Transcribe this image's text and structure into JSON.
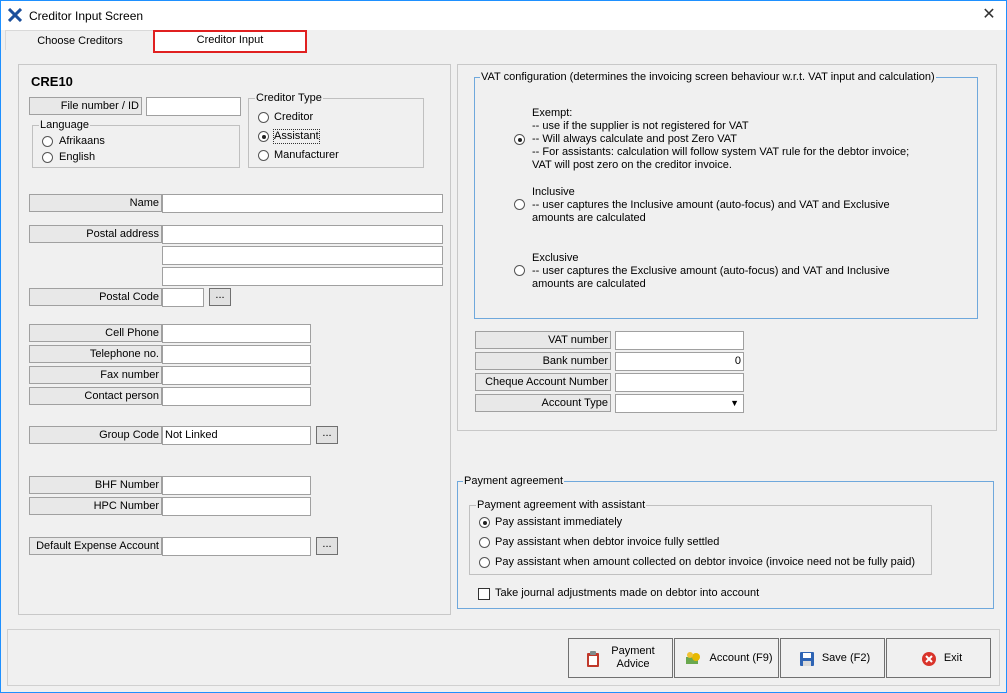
{
  "window": {
    "title": "Creditor Input Screen",
    "close_glyph": "✕"
  },
  "tabs": [
    {
      "label": "Choose Creditors"
    },
    {
      "label": "Creditor Input"
    }
  ],
  "left": {
    "code": "CRE10",
    "file_number": {
      "label": "File number / ID",
      "value": ""
    },
    "language": {
      "title": "Language",
      "options": [
        "Afrikaans",
        "English"
      ],
      "selected": ""
    },
    "creditor_type": {
      "title": "Creditor Type",
      "options": [
        "Creditor",
        "Assistant",
        "Manufacturer"
      ],
      "selected": "Assistant"
    },
    "name": {
      "label": "Name",
      "value": ""
    },
    "postal_address": {
      "label": "Postal address",
      "lines": [
        "",
        "",
        ""
      ]
    },
    "postal_code": {
      "label": "Postal Code",
      "value": "",
      "lookup": "..."
    },
    "cell_phone": {
      "label": "Cell Phone",
      "value": ""
    },
    "telephone": {
      "label": "Telephone no.",
      "value": ""
    },
    "fax": {
      "label": "Fax number",
      "value": ""
    },
    "contact": {
      "label": "Contact person",
      "value": ""
    },
    "group_code": {
      "label": "Group Code",
      "value": "Not Linked",
      "lookup": "..."
    },
    "bhf": {
      "label": "BHF Number",
      "value": ""
    },
    "hpc": {
      "label": "HPC Number",
      "value": ""
    },
    "default_expense": {
      "label": "Default Expense Account",
      "value": "",
      "lookup": "..."
    }
  },
  "vat": {
    "title": "VAT configuration (determines the invoicing screen behaviour w.r.t. VAT input and calculation)",
    "selected": "Exempt",
    "options": [
      {
        "name": "Exempt",
        "text": "Exempt:\n-- use if the supplier is not registered for VAT\n-- Will always calculate and post Zero VAT\n-- For assistants: calculation will follow system VAT rule for the debtor invoice;\nVAT will post zero on the creditor invoice."
      },
      {
        "name": "Inclusive",
        "text": "Inclusive\n-- user captures the Inclusive amount (auto-focus) and VAT and Exclusive\namounts are calculated"
      },
      {
        "name": "Exclusive",
        "text": "Exclusive\n-- user captures the Exclusive amount (auto-focus) and VAT and Inclusive\namounts are calculated"
      }
    ]
  },
  "banking": {
    "vat_number": {
      "label": "VAT number",
      "value": ""
    },
    "bank_number": {
      "label": "Bank number",
      "value": "0"
    },
    "cheque_account": {
      "label": "Cheque Account Number",
      "value": ""
    },
    "account_type": {
      "label": "Account Type",
      "value": "",
      "arrow": "▼"
    }
  },
  "payment": {
    "title": "Payment agreement",
    "sub_title": "Payment agreement with assistant",
    "options": [
      "Pay assistant immediately",
      "Pay assistant when debtor invoice fully settled",
      "Pay assistant when amount collected on debtor invoice (invoice need not be fully paid)"
    ],
    "selected_index": 0,
    "journal_checkbox": {
      "label": "Take journal adjustments made on debtor into account",
      "checked": false
    }
  },
  "buttons": {
    "payment_advice": "Payment\nAdvice",
    "account": "Account (F9)",
    "save": "Save (F2)",
    "exit": "Exit"
  },
  "colors": {
    "highlight_red": "#e02020",
    "group_blue": "#6fa8dc",
    "window_bg": "#f0f0f0"
  }
}
